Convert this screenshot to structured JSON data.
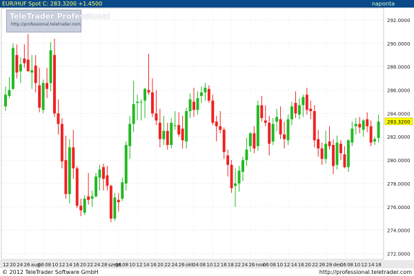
{
  "header": {
    "instrument": "EUR/HUF Spot",
    "close_label": "C: 283.3200",
    "change": "+1.4500",
    "interval": "naponta"
  },
  "logo": {
    "name": "TeleTrader Professional",
    "url": "http://professional.teletrader.com"
  },
  "footer": {
    "copyright": "© 2012 TeleTrader Software GmbH",
    "url": "http://professional.teletrader.com"
  },
  "colors": {
    "up": "#22b822",
    "down": "#ee2222",
    "last_marker": "#ffff00",
    "header_bg": "#0b4a8a"
  },
  "chart_data": {
    "type": "candlestick",
    "ylim": [
      271.5,
      293.0
    ],
    "y_ticks": [
      "272.0000",
      "274.0000",
      "276.0000",
      "278.0000",
      "280.0000",
      "282.0000",
      "284.0000",
      "286.0000",
      "288.0000",
      "290.0000",
      "292.0000"
    ],
    "last_value": "283.3200",
    "x_labels": [
      "12",
      "20",
      "24",
      "26",
      "aug.",
      "06",
      "08",
      "10",
      "12",
      "14",
      "16",
      "20",
      "22",
      "24",
      "28",
      "szept.",
      "06",
      "08",
      "10",
      "12",
      "14",
      "16",
      "20",
      "22",
      "24",
      "26",
      "okt.",
      "04",
      "08",
      "10",
      "12",
      "16",
      "18",
      "22",
      "24",
      "26",
      "nov.",
      "06",
      "08",
      "10",
      "12",
      "14",
      "16",
      "20",
      "22",
      "26",
      "28",
      "dec.",
      "06",
      "08",
      "10",
      "12",
      "14",
      "18"
    ],
    "candles": [
      {
        "o": 284.6,
        "h": 286.3,
        "l": 284.2,
        "c": 285.6
      },
      {
        "o": 285.5,
        "h": 287.1,
        "l": 285.3,
        "c": 286.0
      },
      {
        "o": 286.1,
        "h": 290.0,
        "l": 286.0,
        "c": 289.6
      },
      {
        "o": 289.0,
        "h": 289.9,
        "l": 287.0,
        "c": 287.5
      },
      {
        "o": 287.6,
        "h": 288.8,
        "l": 286.6,
        "c": 288.2
      },
      {
        "o": 288.7,
        "h": 289.9,
        "l": 287.9,
        "c": 288.3
      },
      {
        "o": 288.6,
        "h": 290.8,
        "l": 288.1,
        "c": 287.6
      },
      {
        "o": 287.5,
        "h": 289.0,
        "l": 286.1,
        "c": 287.7
      },
      {
        "o": 288.1,
        "h": 289.0,
        "l": 285.8,
        "c": 286.6
      },
      {
        "o": 286.4,
        "h": 287.9,
        "l": 284.1,
        "c": 284.5
      },
      {
        "o": 284.3,
        "h": 286.9,
        "l": 284.0,
        "c": 286.6
      },
      {
        "o": 286.6,
        "h": 287.9,
        "l": 285.3,
        "c": 286.1
      },
      {
        "o": 286.6,
        "h": 290.1,
        "l": 285.9,
        "c": 289.4
      },
      {
        "o": 289.0,
        "h": 290.4,
        "l": 283.7,
        "c": 284.0
      },
      {
        "o": 284.0,
        "h": 285.2,
        "l": 282.2,
        "c": 283.1
      },
      {
        "o": 283.1,
        "h": 283.6,
        "l": 279.3,
        "c": 279.9
      },
      {
        "o": 280.0,
        "h": 282.1,
        "l": 276.7,
        "c": 277.1
      },
      {
        "o": 277.1,
        "h": 281.8,
        "l": 276.3,
        "c": 281.1
      },
      {
        "o": 281.1,
        "h": 282.6,
        "l": 278.4,
        "c": 279.3
      },
      {
        "o": 279.3,
        "h": 279.5,
        "l": 275.9,
        "c": 276.1
      },
      {
        "o": 276.1,
        "h": 276.7,
        "l": 275.2,
        "c": 275.7
      },
      {
        "o": 275.5,
        "h": 277.0,
        "l": 275.3,
        "c": 276.7
      },
      {
        "o": 276.9,
        "h": 278.9,
        "l": 276.2,
        "c": 276.6
      },
      {
        "o": 276.7,
        "h": 277.4,
        "l": 276.0,
        "c": 276.9
      },
      {
        "o": 276.9,
        "h": 278.9,
        "l": 276.8,
        "c": 278.6
      },
      {
        "o": 278.5,
        "h": 279.6,
        "l": 277.4,
        "c": 279.2
      },
      {
        "o": 279.4,
        "h": 279.7,
        "l": 277.4,
        "c": 278.4
      },
      {
        "o": 278.7,
        "h": 279.5,
        "l": 277.4,
        "c": 277.8
      },
      {
        "o": 277.8,
        "h": 277.9,
        "l": 274.7,
        "c": 275.0
      },
      {
        "o": 275.0,
        "h": 277.2,
        "l": 274.8,
        "c": 276.8
      },
      {
        "o": 276.6,
        "h": 277.2,
        "l": 275.6,
        "c": 276.4
      },
      {
        "o": 276.7,
        "h": 278.5,
        "l": 276.5,
        "c": 278.1
      },
      {
        "o": 278.0,
        "h": 281.6,
        "l": 277.4,
        "c": 281.3
      },
      {
        "o": 281.2,
        "h": 283.8,
        "l": 280.1,
        "c": 283.1
      },
      {
        "o": 283.1,
        "h": 286.8,
        "l": 282.4,
        "c": 284.8
      },
      {
        "o": 284.9,
        "h": 285.6,
        "l": 283.4,
        "c": 285.0
      },
      {
        "o": 285.0,
        "h": 285.2,
        "l": 283.4,
        "c": 285.0
      },
      {
        "o": 285.1,
        "h": 286.2,
        "l": 283.6,
        "c": 286.1
      },
      {
        "o": 286.0,
        "h": 289.1,
        "l": 285.6,
        "c": 285.8
      },
      {
        "o": 285.8,
        "h": 287.0,
        "l": 283.7,
        "c": 284.0
      },
      {
        "o": 284.0,
        "h": 286.0,
        "l": 283.0,
        "c": 283.4
      },
      {
        "o": 283.2,
        "h": 284.4,
        "l": 281.1,
        "c": 281.8
      },
      {
        "o": 281.8,
        "h": 283.8,
        "l": 281.3,
        "c": 282.5
      },
      {
        "o": 282.5,
        "h": 283.2,
        "l": 280.9,
        "c": 281.3
      },
      {
        "o": 281.3,
        "h": 283.6,
        "l": 281.0,
        "c": 283.2
      },
      {
        "o": 283.0,
        "h": 284.2,
        "l": 282.6,
        "c": 283.0
      },
      {
        "o": 283.0,
        "h": 284.1,
        "l": 282.0,
        "c": 282.2
      },
      {
        "o": 282.7,
        "h": 283.8,
        "l": 281.0,
        "c": 281.7
      },
      {
        "o": 281.6,
        "h": 284.5,
        "l": 281.0,
        "c": 284.2
      },
      {
        "o": 284.2,
        "h": 285.7,
        "l": 283.6,
        "c": 285.2
      },
      {
        "o": 285.0,
        "h": 286.2,
        "l": 283.7,
        "c": 284.3
      },
      {
        "o": 284.3,
        "h": 285.9,
        "l": 283.9,
        "c": 285.3
      },
      {
        "o": 285.5,
        "h": 286.3,
        "l": 284.9,
        "c": 285.8
      },
      {
        "o": 285.8,
        "h": 286.6,
        "l": 285.1,
        "c": 286.2
      },
      {
        "o": 286.1,
        "h": 286.4,
        "l": 284.9,
        "c": 285.1
      },
      {
        "o": 285.1,
        "h": 285.6,
        "l": 283.0,
        "c": 283.2
      },
      {
        "o": 283.3,
        "h": 283.8,
        "l": 281.6,
        "c": 282.9
      },
      {
        "o": 282.9,
        "h": 284.2,
        "l": 282.3,
        "c": 282.6
      },
      {
        "o": 282.6,
        "h": 282.8,
        "l": 280.1,
        "c": 280.7
      },
      {
        "o": 280.4,
        "h": 280.9,
        "l": 278.6,
        "c": 279.6
      },
      {
        "o": 279.6,
        "h": 280.0,
        "l": 277.2,
        "c": 277.6
      },
      {
        "o": 277.8,
        "h": 279.3,
        "l": 276.0,
        "c": 278.0
      },
      {
        "o": 278.0,
        "h": 279.5,
        "l": 277.3,
        "c": 279.1
      },
      {
        "o": 279.0,
        "h": 280.3,
        "l": 278.2,
        "c": 280.0
      },
      {
        "o": 280.0,
        "h": 281.9,
        "l": 279.5,
        "c": 280.9
      },
      {
        "o": 281.2,
        "h": 282.4,
        "l": 280.7,
        "c": 282.3
      },
      {
        "o": 282.3,
        "h": 282.9,
        "l": 280.6,
        "c": 281.0
      },
      {
        "o": 281.2,
        "h": 285.1,
        "l": 280.8,
        "c": 284.7
      },
      {
        "o": 284.7,
        "h": 285.5,
        "l": 283.3,
        "c": 283.6
      },
      {
        "o": 283.4,
        "h": 284.7,
        "l": 282.9,
        "c": 283.2
      },
      {
        "o": 283.2,
        "h": 283.8,
        "l": 280.4,
        "c": 281.4
      },
      {
        "o": 281.6,
        "h": 283.6,
        "l": 281.3,
        "c": 283.1
      },
      {
        "o": 283.3,
        "h": 284.4,
        "l": 282.5,
        "c": 283.7
      },
      {
        "o": 283.5,
        "h": 284.6,
        "l": 281.8,
        "c": 282.2
      },
      {
        "o": 282.2,
        "h": 283.3,
        "l": 281.0,
        "c": 281.8
      },
      {
        "o": 281.7,
        "h": 283.9,
        "l": 281.3,
        "c": 283.5
      },
      {
        "o": 283.5,
        "h": 285.0,
        "l": 283.0,
        "c": 284.6
      },
      {
        "o": 284.9,
        "h": 285.9,
        "l": 283.6,
        "c": 284.0
      },
      {
        "o": 283.9,
        "h": 285.3,
        "l": 283.5,
        "c": 284.7
      },
      {
        "o": 284.7,
        "h": 285.6,
        "l": 283.7,
        "c": 285.4
      },
      {
        "o": 285.6,
        "h": 286.2,
        "l": 283.9,
        "c": 284.3
      },
      {
        "o": 284.4,
        "h": 285.1,
        "l": 283.5,
        "c": 284.2
      },
      {
        "o": 284.2,
        "h": 284.7,
        "l": 281.1,
        "c": 281.7
      },
      {
        "o": 281.8,
        "h": 282.6,
        "l": 280.3,
        "c": 281.0
      },
      {
        "o": 281.0,
        "h": 281.5,
        "l": 279.6,
        "c": 280.1
      },
      {
        "o": 280.1,
        "h": 282.5,
        "l": 279.7,
        "c": 281.4
      },
      {
        "o": 281.6,
        "h": 282.9,
        "l": 280.9,
        "c": 281.2
      },
      {
        "o": 281.3,
        "h": 281.8,
        "l": 278.8,
        "c": 279.5
      },
      {
        "o": 279.6,
        "h": 282.1,
        "l": 279.2,
        "c": 281.5
      },
      {
        "o": 281.4,
        "h": 281.7,
        "l": 280.0,
        "c": 280.6
      },
      {
        "o": 280.5,
        "h": 281.2,
        "l": 279.3,
        "c": 279.4
      },
      {
        "o": 279.4,
        "h": 281.8,
        "l": 279.0,
        "c": 281.7
      },
      {
        "o": 281.5,
        "h": 283.3,
        "l": 281.2,
        "c": 282.7
      },
      {
        "o": 282.9,
        "h": 283.6,
        "l": 282.2,
        "c": 283.1
      },
      {
        "o": 283.1,
        "h": 283.7,
        "l": 282.3,
        "c": 282.8
      },
      {
        "o": 282.6,
        "h": 283.5,
        "l": 282.0,
        "c": 283.4
      },
      {
        "o": 283.5,
        "h": 284.1,
        "l": 282.4,
        "c": 282.9
      },
      {
        "o": 282.9,
        "h": 283.4,
        "l": 281.2,
        "c": 281.5
      },
      {
        "o": 281.6,
        "h": 282.0,
        "l": 281.3,
        "c": 281.8
      },
      {
        "o": 281.9,
        "h": 283.9,
        "l": 281.5,
        "c": 283.3
      }
    ]
  }
}
